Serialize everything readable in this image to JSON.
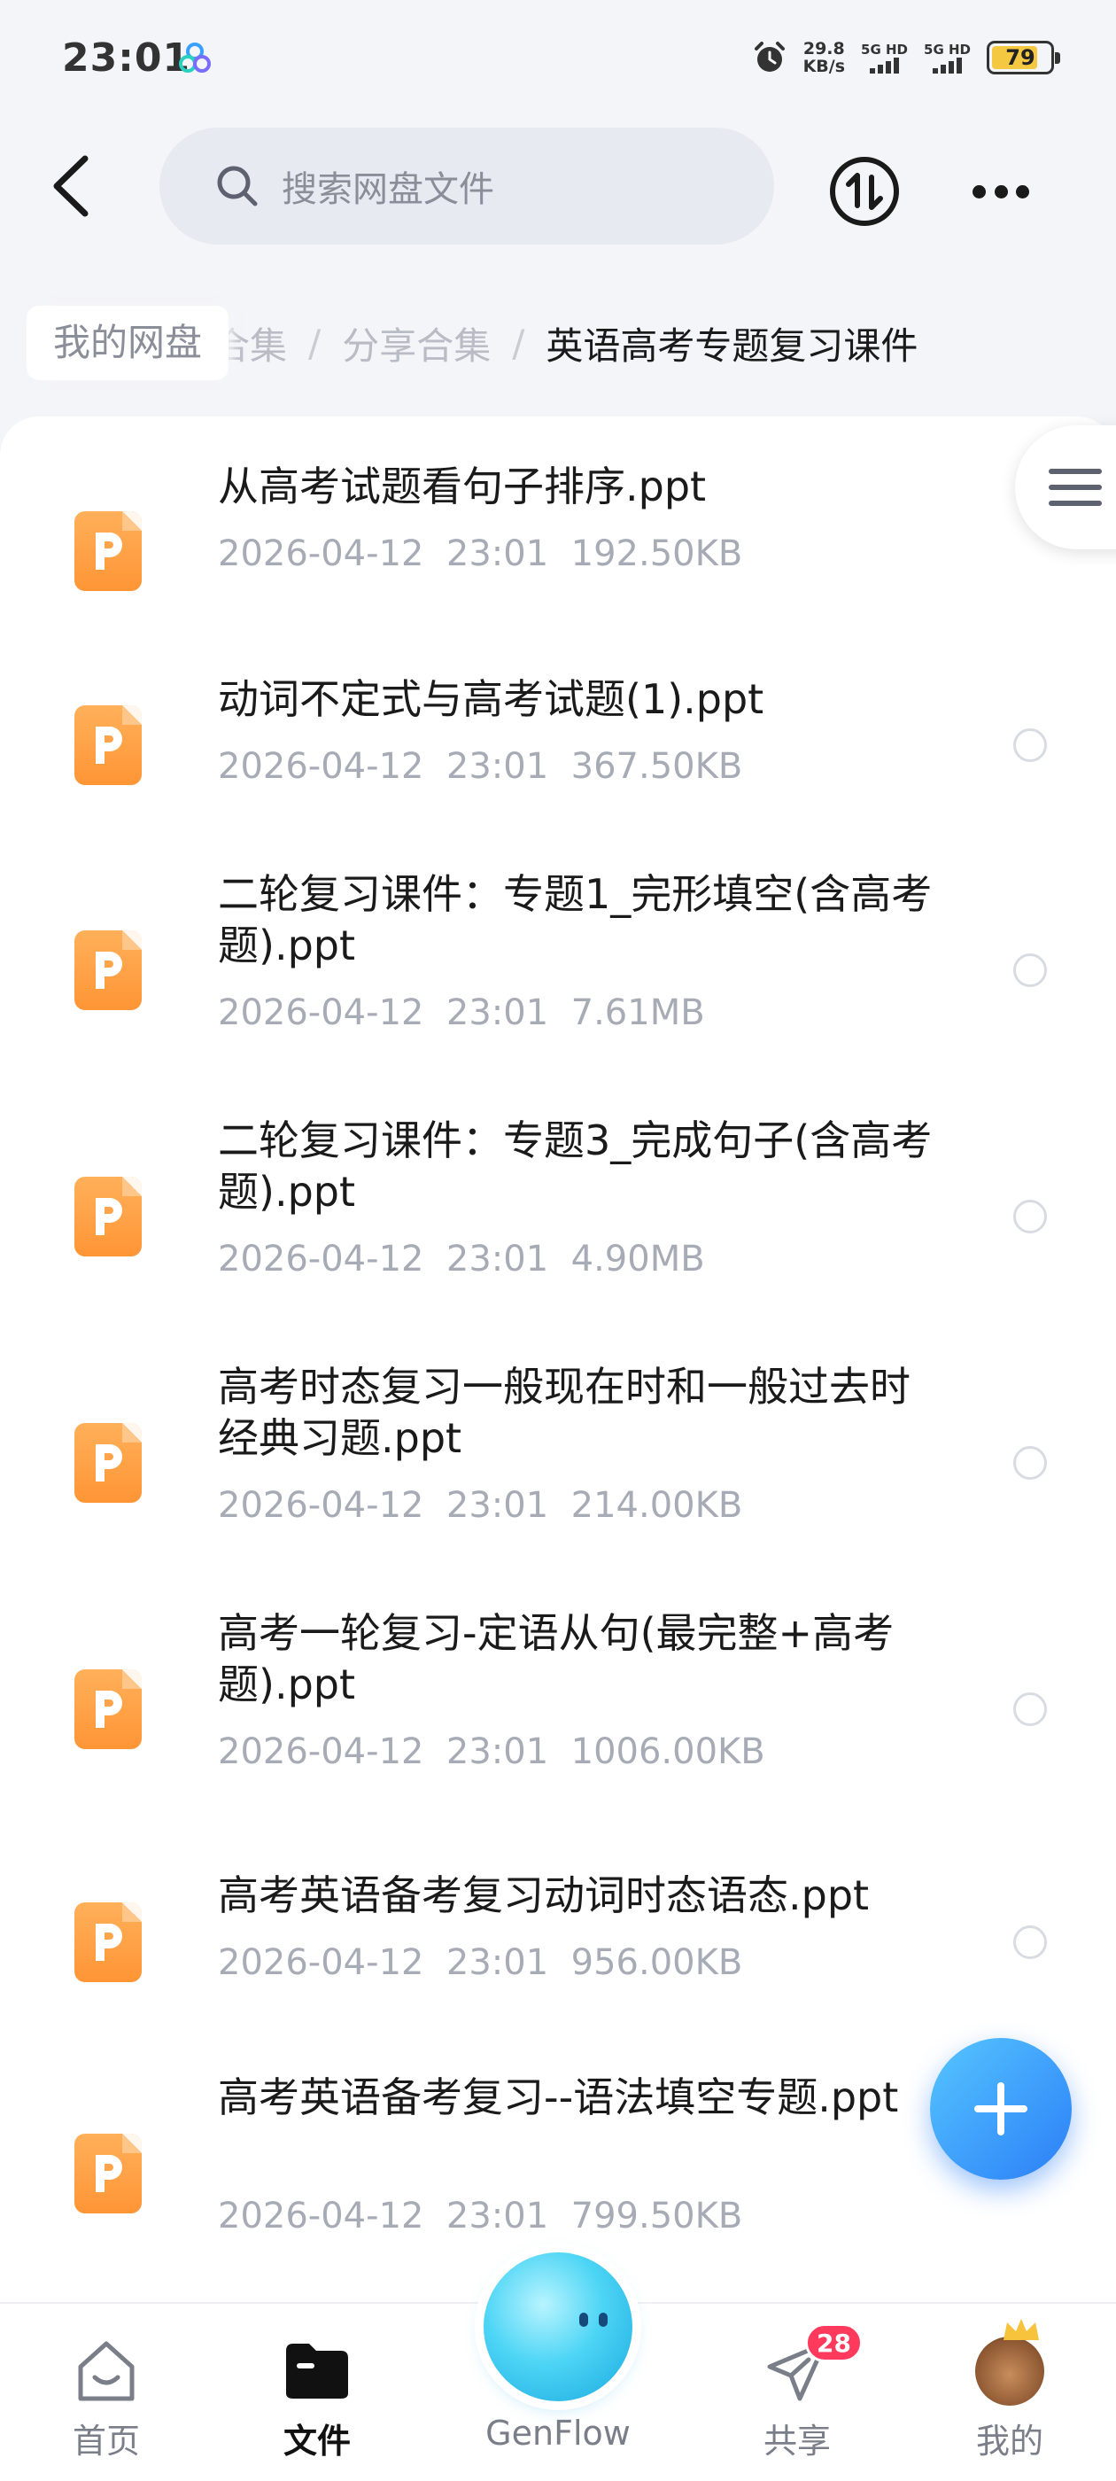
{
  "status_bar": {
    "time": "23:01",
    "net_speed_value": "29.8",
    "net_speed_unit": "KB/s",
    "signal1_label": "5G HD",
    "signal2_label": "5G HD",
    "battery": "79",
    "battery_level": 0.79,
    "icons": [
      "app-logo-icon",
      "alarm-icon",
      "signal-icon",
      "battery-icon"
    ]
  },
  "header": {
    "search_placeholder": "搜索网盘文件",
    "icons": [
      "back-arrow-icon",
      "search-icon",
      "transfer-icon",
      "more-icon"
    ]
  },
  "breadcrumb": {
    "home": "我的网盘",
    "prev_partial": "合集",
    "separator": "/",
    "mid": "分享合集",
    "current": "英语高考专题复习课件"
  },
  "files": [
    {
      "name": "从高考试题看句子排序.ppt",
      "date": "2026-04-12",
      "time": "23:01",
      "size": "192.50KB"
    },
    {
      "name": "动词不定式与高考试题(1).ppt",
      "date": "2026-04-12",
      "time": "23:01",
      "size": "367.50KB"
    },
    {
      "name": "二轮复习课件：专题1_完形填空(含高考题).ppt",
      "date": "2026-04-12",
      "time": "23:01",
      "size": "7.61MB"
    },
    {
      "name": "二轮复习课件：专题3_完成句子(含高考题).ppt",
      "date": "2026-04-12",
      "time": "23:01",
      "size": "4.90MB"
    },
    {
      "name": "高考时态复习一般现在时和一般过去时经典习题.ppt",
      "date": "2026-04-12",
      "time": "23:01",
      "size": "214.00KB"
    },
    {
      "name": "高考一轮复习-定语从句(最完整+高考题).ppt",
      "date": "2026-04-12",
      "time": "23:01",
      "size": "1006.00KB"
    },
    {
      "name": "高考英语备考复习动词时态语态.ppt",
      "date": "2026-04-12",
      "time": "23:01",
      "size": "956.00KB"
    },
    {
      "name": "高考英语备考复习--语法填空专题.ppt",
      "date": "2026-04-12",
      "time": "23:01",
      "size": "799.50KB"
    }
  ],
  "nav": {
    "home": "首页",
    "files": "文件",
    "genflow": "GenFlow",
    "share": "共享",
    "share_badge": "28",
    "mine": "我的"
  },
  "colors": {
    "accent": "#2b7ef7",
    "ppt_icon": "#ff9535",
    "badge": "#ff3a5c",
    "background": "#f4f5f9"
  }
}
